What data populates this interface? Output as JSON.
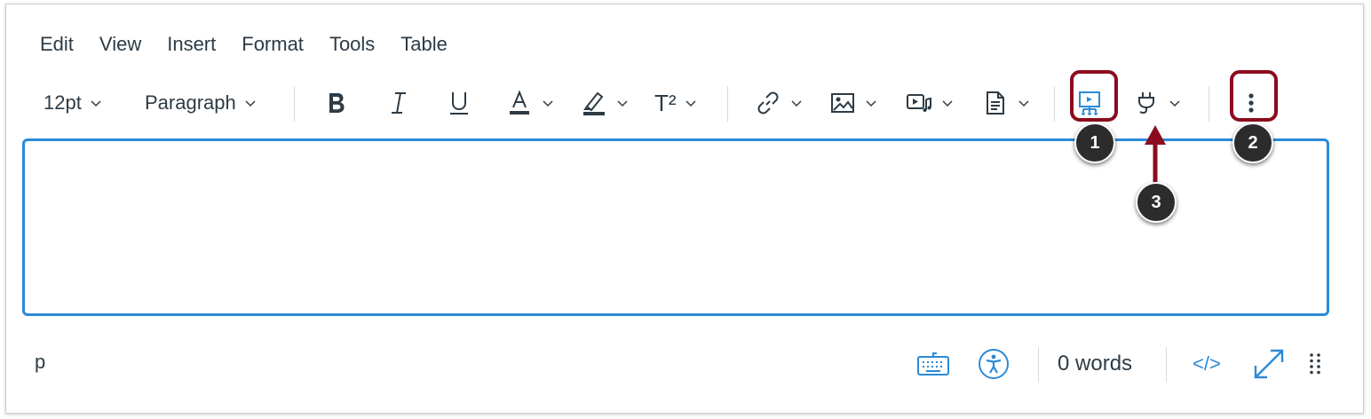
{
  "menubar": {
    "items": [
      {
        "label": "Edit"
      },
      {
        "label": "View"
      },
      {
        "label": "Insert"
      },
      {
        "label": "Format"
      },
      {
        "label": "Tools"
      },
      {
        "label": "Table"
      }
    ]
  },
  "toolbar": {
    "font_size": "12pt",
    "block_format": "Paragraph",
    "superscript_label": "T²",
    "icons": [
      "bold-icon",
      "italic-icon",
      "underline-icon",
      "text-color-icon",
      "highlight-icon",
      "superscript-icon",
      "link-icon",
      "image-icon",
      "media-icon",
      "document-icon",
      "apps-icon",
      "plugin-icon",
      "more-icon"
    ]
  },
  "callouts": {
    "one": "1",
    "two": "2",
    "three": "3"
  },
  "statusbar": {
    "path": "p",
    "word_count": "0 words",
    "html_toggle": "</>"
  },
  "colors": {
    "accent_blue": "#2b8ad8",
    "highlight_red": "#8b0c1e",
    "text": "#2d3b45",
    "callout_bg": "#2c2c2c"
  }
}
